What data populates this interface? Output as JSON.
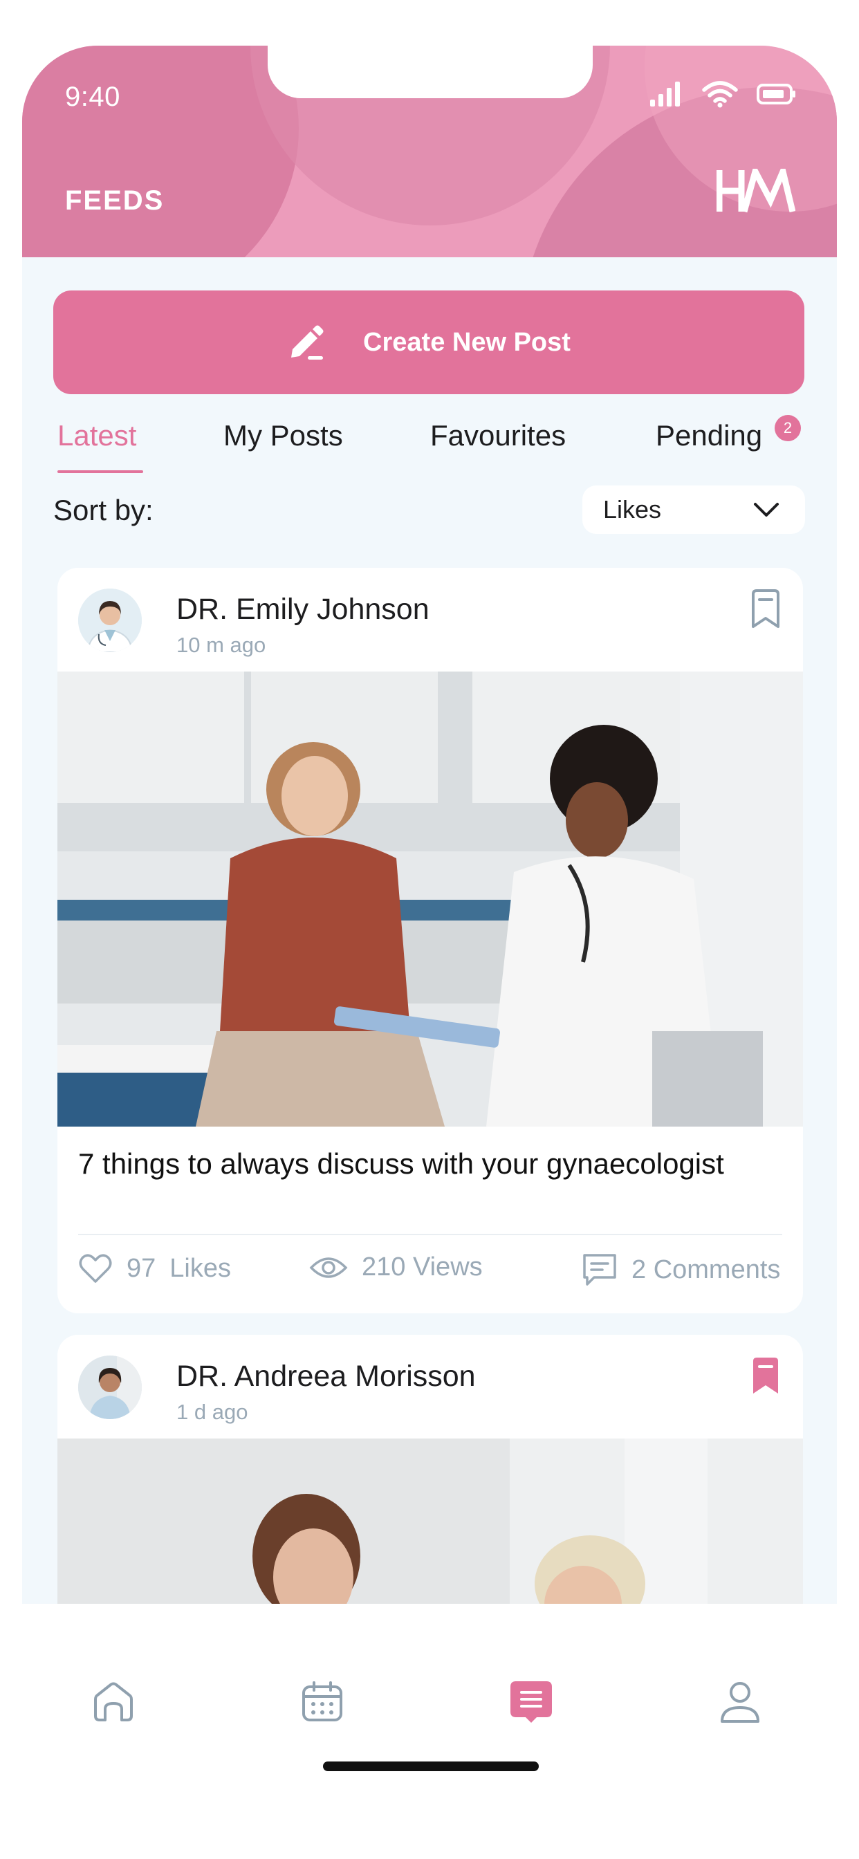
{
  "status_bar": {
    "time": "9:40"
  },
  "header": {
    "title": "FEEDS",
    "logo_text": "HM"
  },
  "create_post": {
    "label": "Create New Post",
    "icon": "edit-pencil-icon"
  },
  "tabs": [
    {
      "label": "Latest",
      "active": true
    },
    {
      "label": "My Posts",
      "active": false
    },
    {
      "label": "Favourites",
      "active": false
    },
    {
      "label": "Pending",
      "active": false,
      "badge": "2"
    }
  ],
  "sort": {
    "label": "Sort by:",
    "value": "Likes"
  },
  "posts": [
    {
      "author": "DR. Emily Johnson",
      "time_ago": "10 m ago",
      "bookmarked": false,
      "title": "7 things to always discuss with your gynaecologist",
      "likes": "97",
      "likes_label": "Likes",
      "views": "210 Views",
      "comments": "2 Comments"
    },
    {
      "author": "DR. Andreea Morisson",
      "time_ago": "1 d ago",
      "bookmarked": true
    }
  ],
  "bottom_nav": [
    {
      "name": "home",
      "icon": "home-icon",
      "active": false
    },
    {
      "name": "calendar",
      "icon": "calendar-icon",
      "active": false
    },
    {
      "name": "feeds",
      "icon": "feed-icon",
      "active": true
    },
    {
      "name": "profile",
      "icon": "profile-icon",
      "active": false
    }
  ],
  "colors": {
    "accent": "#e2739b",
    "header_pink": "#ec9cbb",
    "background": "#f2f8fc",
    "muted_text": "#9aa9b6",
    "icon_gray": "#8fa0ae"
  }
}
